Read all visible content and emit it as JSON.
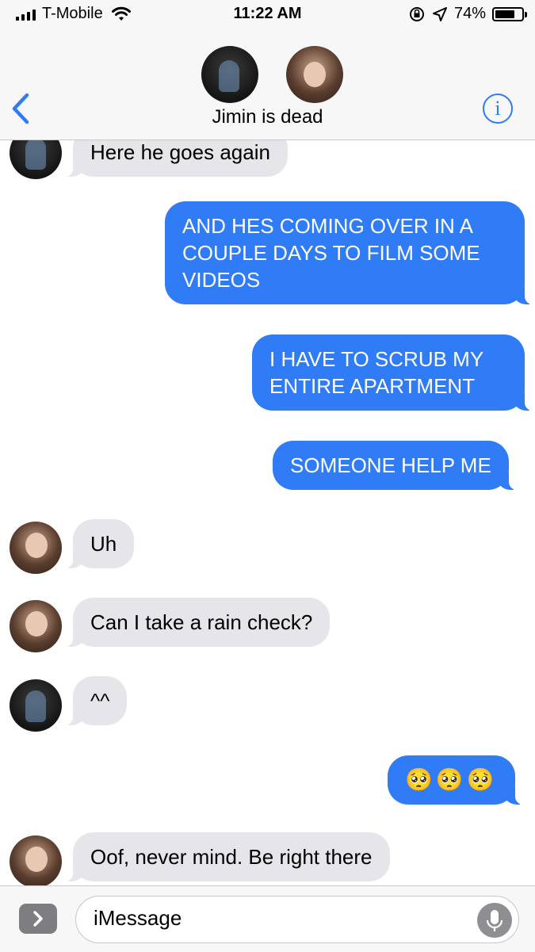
{
  "status_bar": {
    "carrier": "T-Mobile",
    "time": "11:22 AM",
    "battery": "74%",
    "battery_level": 0.74
  },
  "header": {
    "title": "Jimin is dead"
  },
  "messages": [
    {
      "text": "Here he goes again",
      "direction": "incoming",
      "sender_avatar": "avatar-a"
    },
    {
      "text": "AND HES COMING OVER IN A COUPLE DAYS TO FILM SOME VIDEOS",
      "direction": "outgoing"
    },
    {
      "text": "I HAVE TO SCRUB MY ENTIRE APARTMENT",
      "direction": "outgoing"
    },
    {
      "text": "SOMEONE HELP ME",
      "direction": "outgoing"
    },
    {
      "text": "Uh",
      "direction": "incoming",
      "sender_avatar": "avatar-b"
    },
    {
      "text": "Can I take a rain check?",
      "direction": "incoming",
      "sender_avatar": "avatar-b"
    },
    {
      "text": "^^",
      "direction": "incoming",
      "sender_avatar": "avatar-a"
    },
    {
      "text": "🥺🥺🥺",
      "direction": "outgoing"
    },
    {
      "text": "Oof, never mind. Be right there",
      "direction": "incoming",
      "sender_avatar": "avatar-b"
    }
  ],
  "input": {
    "placeholder": "iMessage"
  },
  "colors": {
    "outgoing_bubble": "#2f7cf6",
    "incoming_bubble": "#e5e5ea",
    "accent": "#2f7cf6"
  }
}
